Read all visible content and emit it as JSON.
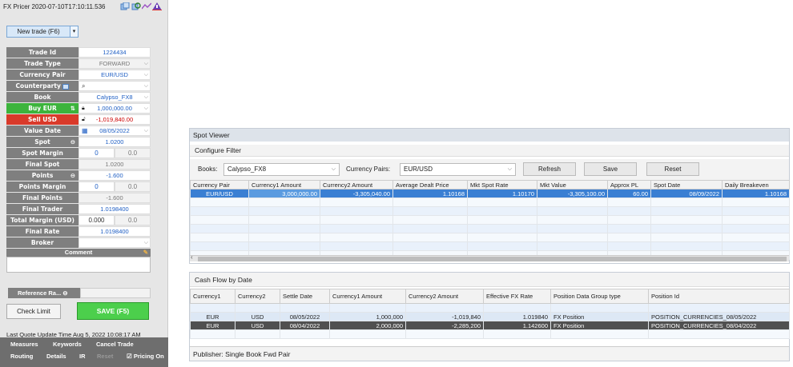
{
  "pricer": {
    "title": "FX Pricer 2020-07-10T17:10:11.536",
    "new_trade_label": "New trade (F6)",
    "fields": {
      "trade_id": {
        "label": "Trade Id",
        "value": "1224434"
      },
      "trade_type": {
        "label": "Trade Type",
        "value": "FORWARD"
      },
      "currency_pair": {
        "label": "Currency Pair",
        "value": "EUR/USD"
      },
      "counterparty": {
        "label": "Counterparty",
        "value": ""
      },
      "book": {
        "label": "Book",
        "value": "Calypso_FX8"
      },
      "buy": {
        "label": "Buy EUR",
        "value": "1,000,000.00"
      },
      "sell": {
        "label": "Sell USD",
        "value": "-1,019,840.00"
      },
      "value_date": {
        "label": "Value Date",
        "value": "08/05/2022"
      },
      "spot": {
        "label": "Spot",
        "value": "1.0200"
      },
      "spot_margin": {
        "label": "Spot Margin",
        "value": "0",
        "value2": "0.0"
      },
      "final_spot": {
        "label": "Final Spot",
        "value": "1.0200"
      },
      "points": {
        "label": "Points",
        "value": "-1.600"
      },
      "points_margin": {
        "label": "Points Margin",
        "value": "0",
        "value2": "0.0"
      },
      "final_points": {
        "label": "Final Points",
        "value": "-1.600"
      },
      "final_trader": {
        "label": "Final Trader",
        "value": "1.0198400"
      },
      "total_margin": {
        "label": "Total Margin (USD)",
        "value": "0.000",
        "value2": "0.0"
      },
      "final_rate": {
        "label": "Final Rate",
        "value": "1.0198400"
      },
      "broker": {
        "label": "Broker",
        "value": ""
      }
    },
    "comment_label": "Comment",
    "reference_rate_label": "Reference Ra...",
    "check_limit_label": "Check Limit",
    "save_label": "SAVE (F5)",
    "last_quote": "Last Quote Update Time Aug 5, 2022 10:08:17 AM",
    "bottom_bar": {
      "measures": "Measures",
      "keywords": "Keywords",
      "cancel_trade": "Cancel Trade",
      "routing": "Routing",
      "details": "Details",
      "ir": "IR",
      "reset": "Reset",
      "pricing": "Pricing On"
    }
  },
  "spot_viewer": {
    "title": "Spot Viewer",
    "configure_filter": "Configure Filter",
    "books_label": "Books:",
    "books_value": "Calypso_FX8",
    "pairs_label": "Currency Pairs:",
    "pairs_value": "EUR/USD",
    "refresh": "Refresh",
    "save": "Save",
    "reset": "Reset",
    "columns": [
      "Currency Pair",
      "Currency1 Amount",
      "Currency2 Amount",
      "Average Dealt Price",
      "Mkt Spot Rate",
      "Mkt Value",
      "Approx PL",
      "Spot Date",
      "Daily Breakeven"
    ],
    "rows": [
      [
        "EUR/USD",
        "3,000,000.00",
        "-3,305,040.00",
        "1.10168",
        "1.10170",
        "-3,305,100.00",
        "60.00",
        "08/09/2022",
        "1.10168"
      ]
    ]
  },
  "cash_flow": {
    "title": "Cash Flow by Date",
    "columns": [
      "Currency1",
      "Currency2",
      "Settle Date",
      "Currency1 Amount",
      "Currency2 Amount",
      "Effective FX Rate",
      "Position Data Group type",
      "Position Id"
    ],
    "rows": [
      [
        "EUR",
        "USD",
        "08/05/2022",
        "1,000,000",
        "-1,019,840",
        "1.019840",
        "FX Position",
        "POSITION_CURRENCIES_08/05/2022"
      ],
      [
        "EUR",
        "USD",
        "08/04/2022",
        "2,000,000",
        "-2,285,200",
        "1.142600",
        "FX Position",
        "POSITION_CURRENCIES_08/04/2022"
      ]
    ],
    "publisher": "Publisher: Single Book Fwd Pair"
  }
}
